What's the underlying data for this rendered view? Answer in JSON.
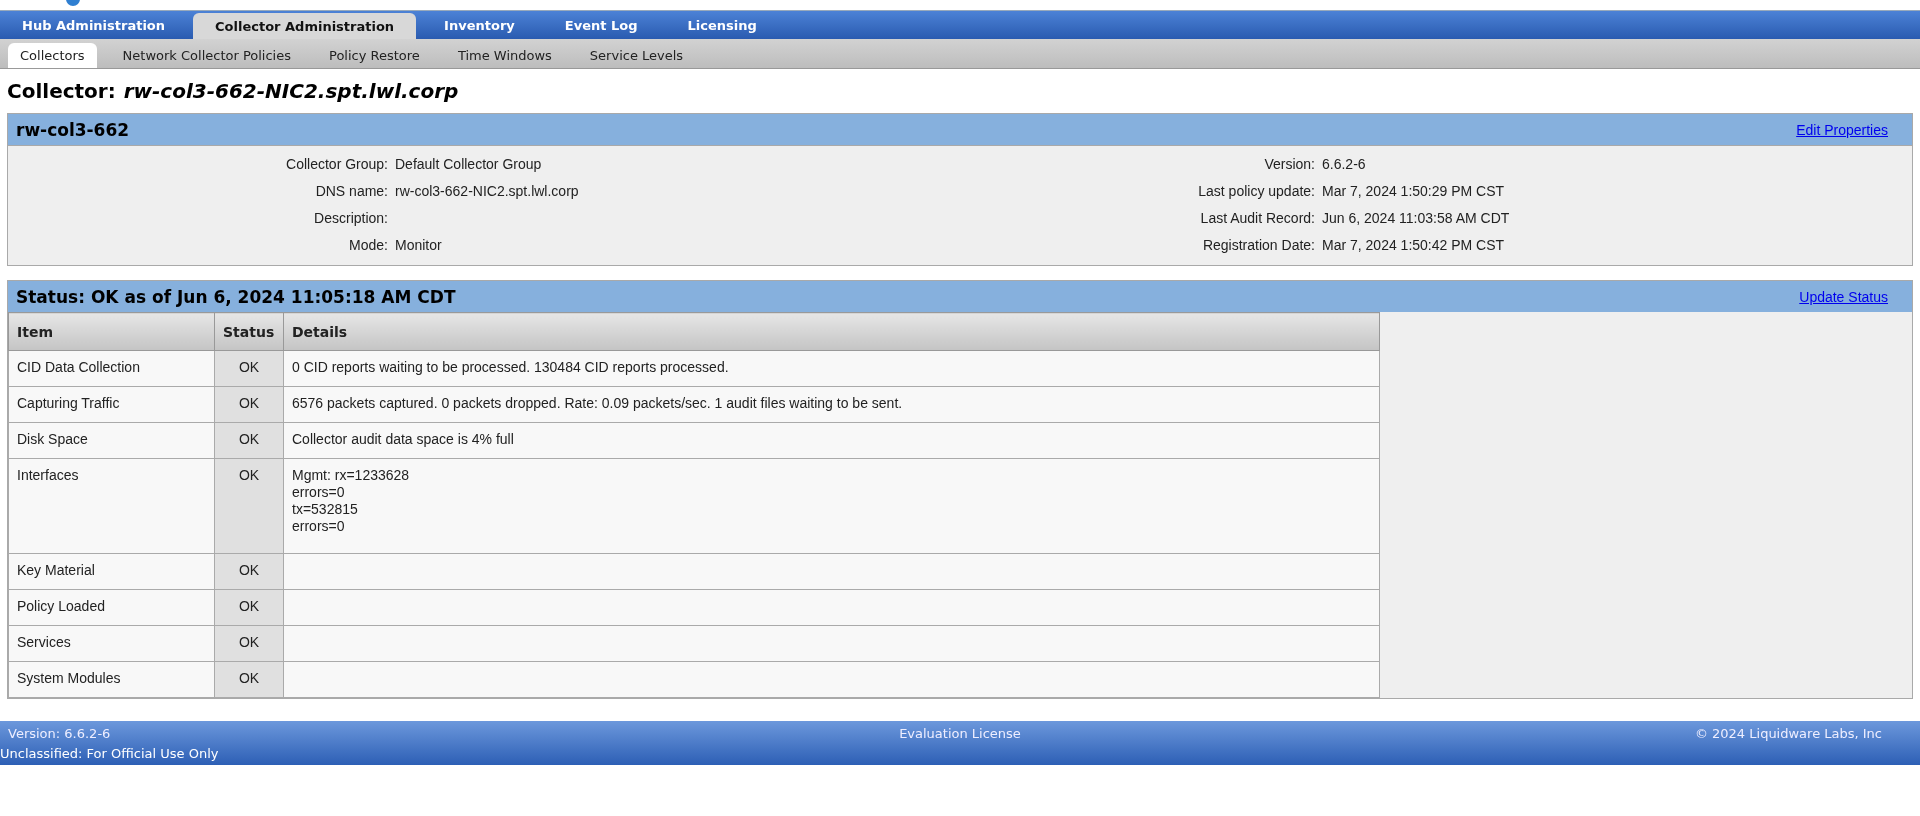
{
  "main_tabs": [
    {
      "label": "Hub Administration",
      "selected": false
    },
    {
      "label": "Collector Administration",
      "selected": true
    },
    {
      "label": "Inventory",
      "selected": false
    },
    {
      "label": "Event Log",
      "selected": false
    },
    {
      "label": "Licensing",
      "selected": false
    }
  ],
  "sub_tabs": [
    {
      "label": "Collectors",
      "selected": true
    },
    {
      "label": "Network Collector Policies",
      "selected": false
    },
    {
      "label": "Policy Restore",
      "selected": false
    },
    {
      "label": "Time Windows",
      "selected": false
    },
    {
      "label": "Service Levels",
      "selected": false
    }
  ],
  "page_title": {
    "prefix": "Collector:",
    "name": "rw-col3-662-NIC2.spt.lwl.corp"
  },
  "collector_panel": {
    "title": "rw-col3-662",
    "action": "Edit Properties",
    "left_fields": [
      {
        "label": "Collector Group:",
        "value": "Default Collector Group"
      },
      {
        "label": "DNS name:",
        "value": "rw-col3-662-NIC2.spt.lwl.corp"
      },
      {
        "label": "Description:"
      },
      {
        "label": "Mode:",
        "value": "Monitor"
      }
    ],
    "right_fields": [
      {
        "label": "Version:",
        "value": "6.6.2-6"
      },
      {
        "label": "Last policy update:",
        "value": "Mar 7, 2024 1:50:29 PM CST"
      },
      {
        "label": "Last Audit Record:",
        "value": "Jun 6, 2024 11:03:58 AM CDT"
      },
      {
        "label": "Registration Date:",
        "value": "Mar 7, 2024 1:50:42 PM CST"
      }
    ]
  },
  "status_panel": {
    "title": "Status: OK as of Jun 6, 2024 11:05:18 AM CDT",
    "action": "Update Status",
    "columns": [
      "Item",
      "Status",
      "Details"
    ],
    "rows": [
      {
        "item": "CID Data Collection",
        "status": "OK",
        "details": [
          "0 CID reports waiting to be processed. 130484 CID reports processed."
        ]
      },
      {
        "item": "Capturing Traffic",
        "status": "OK",
        "details": [
          "6576 packets captured. 0 packets dropped. Rate: 0.09 packets/sec. 1 audit files waiting to be sent."
        ]
      },
      {
        "item": "Disk Space",
        "status": "OK",
        "details": [
          "Collector audit data space is 4% full"
        ]
      },
      {
        "item": "Interfaces",
        "status": "OK",
        "details": [
          "Mgmt: rx=1233628",
          "errors=0",
          "tx=532815",
          "errors=0"
        ]
      },
      {
        "item": "Key Material",
        "status": "OK"
      },
      {
        "item": "Policy Loaded",
        "status": "OK"
      },
      {
        "item": "Services",
        "status": "OK"
      },
      {
        "item": "System Modules",
        "status": "OK"
      }
    ]
  },
  "footer": {
    "version": "Version: 6.6.2-6",
    "license": "Evaluation License",
    "copyright": "© 2024 Liquidware Labs, Inc"
  },
  "classification": "Unclassified: For Official Use Only"
}
